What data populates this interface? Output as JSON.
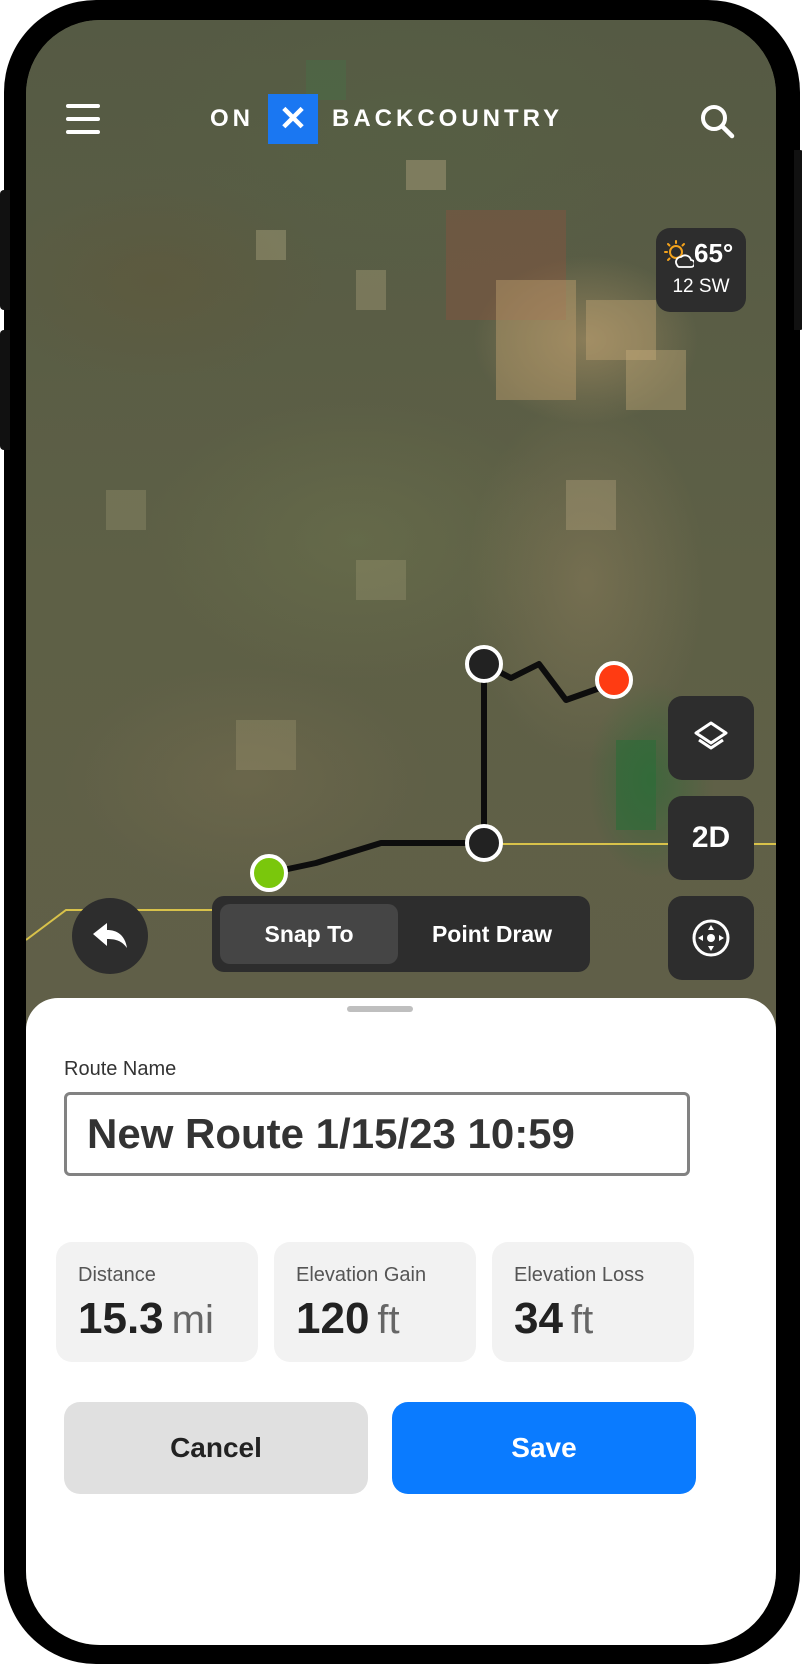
{
  "header": {
    "logo_left": "ON",
    "logo_mark": "✕",
    "logo_right": "BACKCOUNTRY"
  },
  "weather": {
    "temperature": "65°",
    "wind": "12 SW"
  },
  "map_controls": {
    "layers_icon": "layers-icon",
    "view_mode_label": "2D",
    "locate_icon": "compass-icon"
  },
  "route_modes": {
    "options": [
      "Snap To",
      "Point Draw"
    ],
    "selected": "Snap To"
  },
  "sheet": {
    "route_name_label": "Route Name",
    "route_name_value": "New Route 1/15/23 10:59",
    "stats": [
      {
        "label": "Distance",
        "value": "15.3",
        "unit": "mi"
      },
      {
        "label": "Elevation Gain",
        "value": "120",
        "unit": "ft"
      },
      {
        "label": "Elevation Loss",
        "value": "34",
        "unit": "ft"
      }
    ],
    "cancel_label": "Cancel",
    "save_label": "Save"
  },
  "colors": {
    "brand_blue": "#1a77f2",
    "save_blue": "#0a7bff",
    "start_point": "#7ac70c",
    "end_point": "#ff3b12",
    "control_bg": "#2d2d2d"
  }
}
